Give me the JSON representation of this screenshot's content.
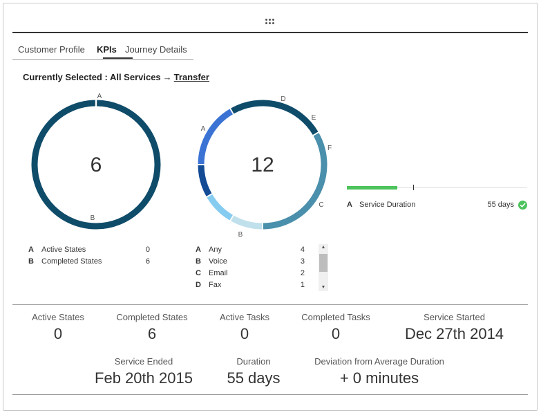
{
  "tabs": [
    {
      "label": "Customer Profile"
    },
    {
      "label": "KPIs"
    },
    {
      "label": "Journey Details"
    }
  ],
  "selection": {
    "prefix": "Currently Selected : All Services",
    "arrow": "→",
    "link": "Transfer"
  },
  "donut1": {
    "total": "6",
    "segments": [
      {
        "key": "A",
        "value": 0,
        "color": "#0f4c6a"
      },
      {
        "key": "B",
        "value": 6,
        "color": "#0f4c6a"
      }
    ],
    "legend": [
      {
        "key": "A",
        "label": "Active States",
        "value": "0"
      },
      {
        "key": "B",
        "label": "Completed States",
        "value": "6"
      }
    ]
  },
  "donut2": {
    "total": "12",
    "segments": [
      {
        "key": "A",
        "value": 4,
        "color": "#4a8fab"
      },
      {
        "key": "B",
        "value": 3,
        "color": "#0f4c6a"
      },
      {
        "key": "C",
        "value": 2,
        "color": "#3b73d4"
      },
      {
        "key": "F",
        "value": 1,
        "color": "#134b94"
      },
      {
        "key": "E",
        "value": 1,
        "color": "#86cbf0"
      },
      {
        "key": "D",
        "value": 1,
        "color": "#c0e0ec"
      }
    ],
    "legend": [
      {
        "key": "A",
        "label": "Any",
        "value": "4"
      },
      {
        "key": "B",
        "label": "Voice",
        "value": "3"
      },
      {
        "key": "C",
        "label": "Email",
        "value": "2"
      },
      {
        "key": "D",
        "label": "Fax",
        "value": "1"
      }
    ]
  },
  "service_duration": {
    "key": "A",
    "label": "Service Duration",
    "value": "55 days",
    "progress_fraction": 0.28,
    "colors": {
      "fill": "#4cc35c",
      "check": "#4cc35c"
    }
  },
  "stats": {
    "active_states": {
      "label": "Active States",
      "value": "0"
    },
    "completed_states": {
      "label": "Completed States",
      "value": "6"
    },
    "active_tasks": {
      "label": "Active Tasks",
      "value": "0"
    },
    "completed_tasks": {
      "label": "Completed Tasks",
      "value": "0"
    },
    "service_started": {
      "label": "Service Started",
      "value": "Dec 27th 2014"
    },
    "service_ended": {
      "label": "Service Ended",
      "value": "Feb 20th 2015"
    },
    "duration": {
      "label": "Duration",
      "value": "55 days"
    },
    "deviation": {
      "label": "Deviation from Average Duration",
      "value": "+ 0 minutes"
    }
  }
}
